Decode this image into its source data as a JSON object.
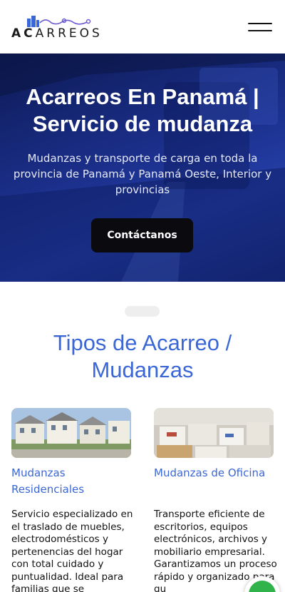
{
  "header": {
    "logo_prefix": "AC",
    "logo_suffix": "ARREOS",
    "menu_icon": "hamburger-menu-icon"
  },
  "hero": {
    "title": "Acarreos En Panamá | Servicio de mudanza",
    "subtitle": "Mudanzas y transporte de carga en toda la provincia de Panamá y Panamá Oeste, Interior y provincias",
    "cta_label": "Contáctanos"
  },
  "services": {
    "title": "Tipos de Acarreo / Mudanzas",
    "cards": [
      {
        "title": "Mudanzas Residenciales",
        "text": "Servicio especializado en el traslado de muebles, electrodomésticos y pertenencias del hogar con total cuidado y puntualidad. Ideal para familias que se",
        "image_icon": "residential-houses-image"
      },
      {
        "title": "Mudanzas de Oficina",
        "text": "Transporte eficiente de escritorios, equipos electrónicos, archivos y mobiliario empresarial. Garantizamos un proceso rápido y organizado para qu",
        "image_icon": "office-boxes-image"
      }
    ]
  },
  "floating": {
    "whatsapp_icon": "whatsapp-icon"
  },
  "colors": {
    "accent": "#3b67d6",
    "hero_blue": "#1b2f8a",
    "button_dark": "#0b0b0f",
    "whatsapp_green": "#2fb34a"
  }
}
